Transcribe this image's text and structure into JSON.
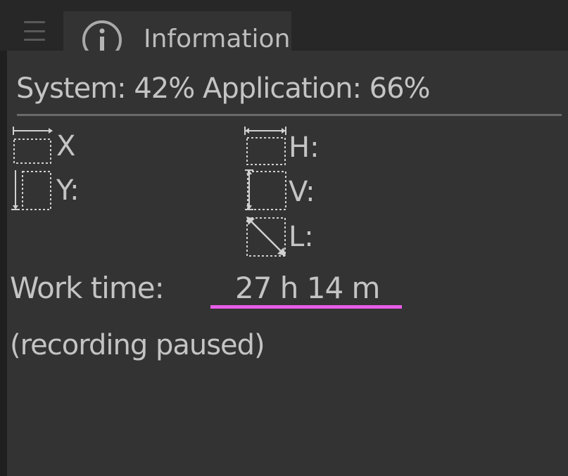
{
  "tab": {
    "label": "Information",
    "icon": "info-icon"
  },
  "menu": {
    "icon": "hamburger-menu-icon"
  },
  "usage": {
    "text": "System: 42%  Application: 66%"
  },
  "dimensions": {
    "x_label": "X",
    "y_label": "Y:",
    "h_label": "H:",
    "v_label": "V:",
    "l_label": "L:"
  },
  "work": {
    "label": "Work time:",
    "value": "27 h  14 m",
    "underline_color": "#e75ce7"
  },
  "status": {
    "text": "(recording paused)"
  },
  "colors": {
    "background": "#272727",
    "panel": "#333333",
    "text": "#c4c4c4",
    "accent": "#e75ce7"
  }
}
